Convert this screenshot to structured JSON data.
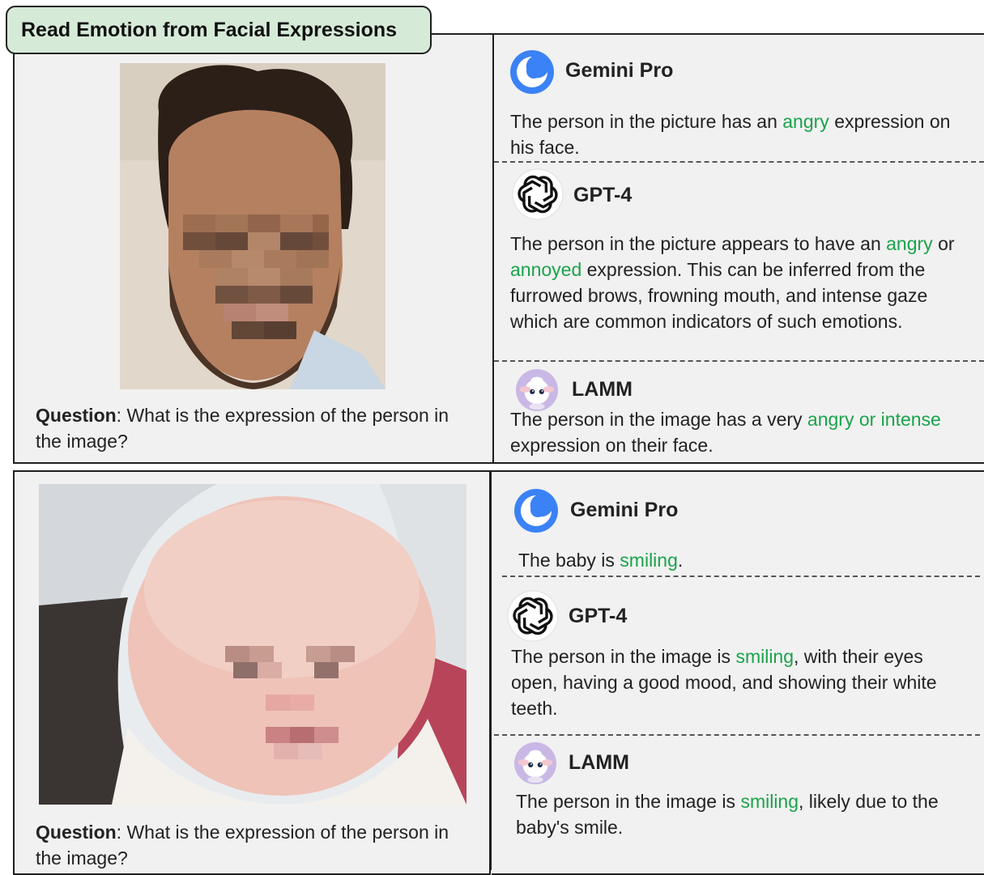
{
  "title": "Read Emotion from Facial Expressions",
  "cases": [
    {
      "question_label": "Question",
      "question_text": ": What is the expression of the person in the image?",
      "responses": [
        {
          "model": "Gemini Pro",
          "icon": "gemini-icon",
          "segments": [
            "The person in the picture has an ",
            "angry",
            " expression on his face."
          ]
        },
        {
          "model": "GPT-4",
          "icon": "openai-icon",
          "segments": [
            "The person in the picture appears to have an ",
            "angry",
            " or ",
            "annoyed",
            " expression. This can be inferred from the furrowed brows, frowning mouth, and intense gaze which are common indicators of such emotions."
          ]
        },
        {
          "model": "LAMM",
          "icon": "lamb-avatar-icon",
          "segments": [
            "The person in the image has a very ",
            "angry or intense",
            " expression on their face."
          ]
        }
      ]
    },
    {
      "question_label": "Question",
      "question_text": ": What is the expression of the person in the image?",
      "responses": [
        {
          "model": "Gemini Pro",
          "icon": "gemini-icon",
          "segments": [
            "The baby is ",
            "smiling",
            "."
          ]
        },
        {
          "model": "GPT-4",
          "icon": "openai-icon",
          "segments": [
            "The person in the image is ",
            "smiling",
            ", with their eyes open, having a good mood, and showing their white teeth."
          ]
        },
        {
          "model": "LAMM",
          "icon": "lamb-avatar-icon",
          "segments": [
            "The person in the image is ",
            "smiling",
            ", likely due to the baby's smile."
          ]
        }
      ]
    }
  ],
  "colors": {
    "highlight": "#1aa34a",
    "title_bg": "#d6ead8",
    "panel_bg": "#f1f1f1",
    "gemini": "#3b82f6"
  }
}
